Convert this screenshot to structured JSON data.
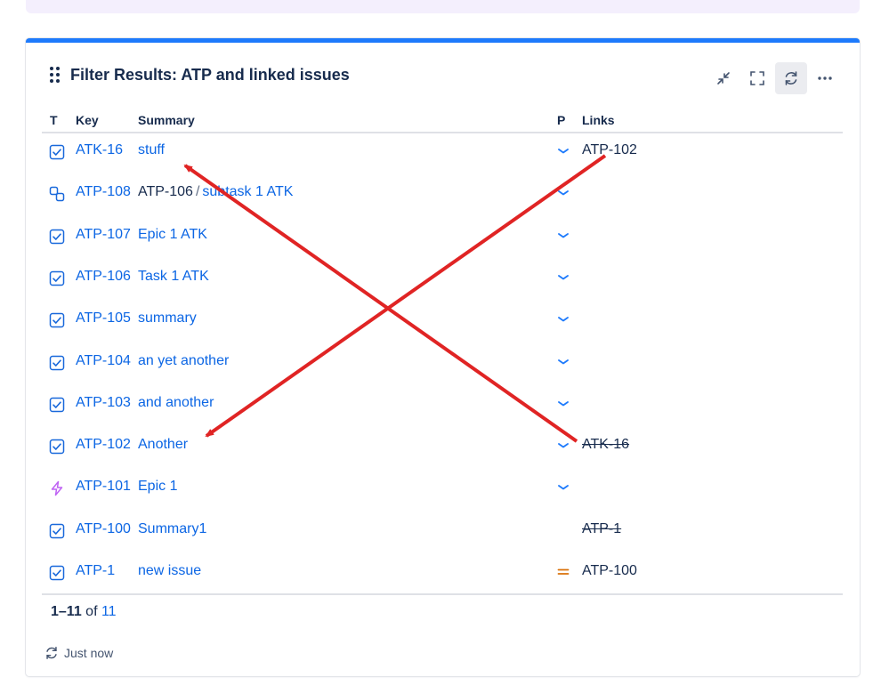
{
  "gadget": {
    "title": "Filter Results: ATP and linked issues",
    "accent_color": "#1d7afc",
    "actions": [
      {
        "name": "minimize-icon"
      },
      {
        "name": "fullscreen-icon"
      },
      {
        "name": "refresh-icon",
        "active": true
      },
      {
        "name": "more-icon"
      }
    ]
  },
  "columns": {
    "type": "T",
    "key": "Key",
    "summary": "Summary",
    "priority": "P",
    "links": "Links"
  },
  "rows": [
    {
      "type": "task",
      "key": "ATK-16",
      "summary": "stuff",
      "priority": "low",
      "link": "ATP-102",
      "link_done": false
    },
    {
      "type": "subtask",
      "key": "ATP-108",
      "parent": "ATP-106",
      "summary": "subtask 1 ATK",
      "priority": "low",
      "link": "",
      "link_done": false
    },
    {
      "type": "task",
      "key": "ATP-107",
      "summary": "Epic 1 ATK",
      "priority": "low",
      "link": "",
      "link_done": false
    },
    {
      "type": "task",
      "key": "ATP-106",
      "summary": "Task 1 ATK",
      "priority": "low",
      "link": "",
      "link_done": false
    },
    {
      "type": "task",
      "key": "ATP-105",
      "summary": "summary",
      "priority": "low",
      "link": "",
      "link_done": false
    },
    {
      "type": "task",
      "key": "ATP-104",
      "summary": "an yet another",
      "priority": "low",
      "link": "",
      "link_done": false
    },
    {
      "type": "task",
      "key": "ATP-103",
      "summary": "and another",
      "priority": "low",
      "link": "",
      "link_done": false
    },
    {
      "type": "task",
      "key": "ATP-102",
      "summary": "Another",
      "priority": "low",
      "link": "ATK-16",
      "link_done": true
    },
    {
      "type": "epic",
      "key": "ATP-101",
      "summary": "Epic 1",
      "priority": "low",
      "link": "",
      "link_done": false
    },
    {
      "type": "task",
      "key": "ATP-100",
      "summary": "Summary1",
      "priority": "",
      "link": "ATP-1",
      "link_done": true
    },
    {
      "type": "task",
      "key": "ATP-1",
      "summary": "new issue",
      "priority": "medium",
      "link": "ATP-100",
      "link_done": false
    }
  ],
  "pagination": {
    "range": "1–11",
    "of": "of",
    "total": "11"
  },
  "refresh": {
    "label": "Just now"
  },
  "colors": {
    "link": "#0c66e4",
    "task_icon": "#1868db",
    "epic_icon": "#bf63f3",
    "priority_low": "#1d7afc",
    "priority_medium": "#d97008",
    "annotation_arrow": "#e02424"
  },
  "annotations": [
    {
      "name": "arrow-links-to-stuff",
      "from": "ATP-102 link",
      "to": "stuff"
    },
    {
      "name": "arrow-links-to-another",
      "from": "ATK-16 link",
      "to": "Another"
    }
  ]
}
